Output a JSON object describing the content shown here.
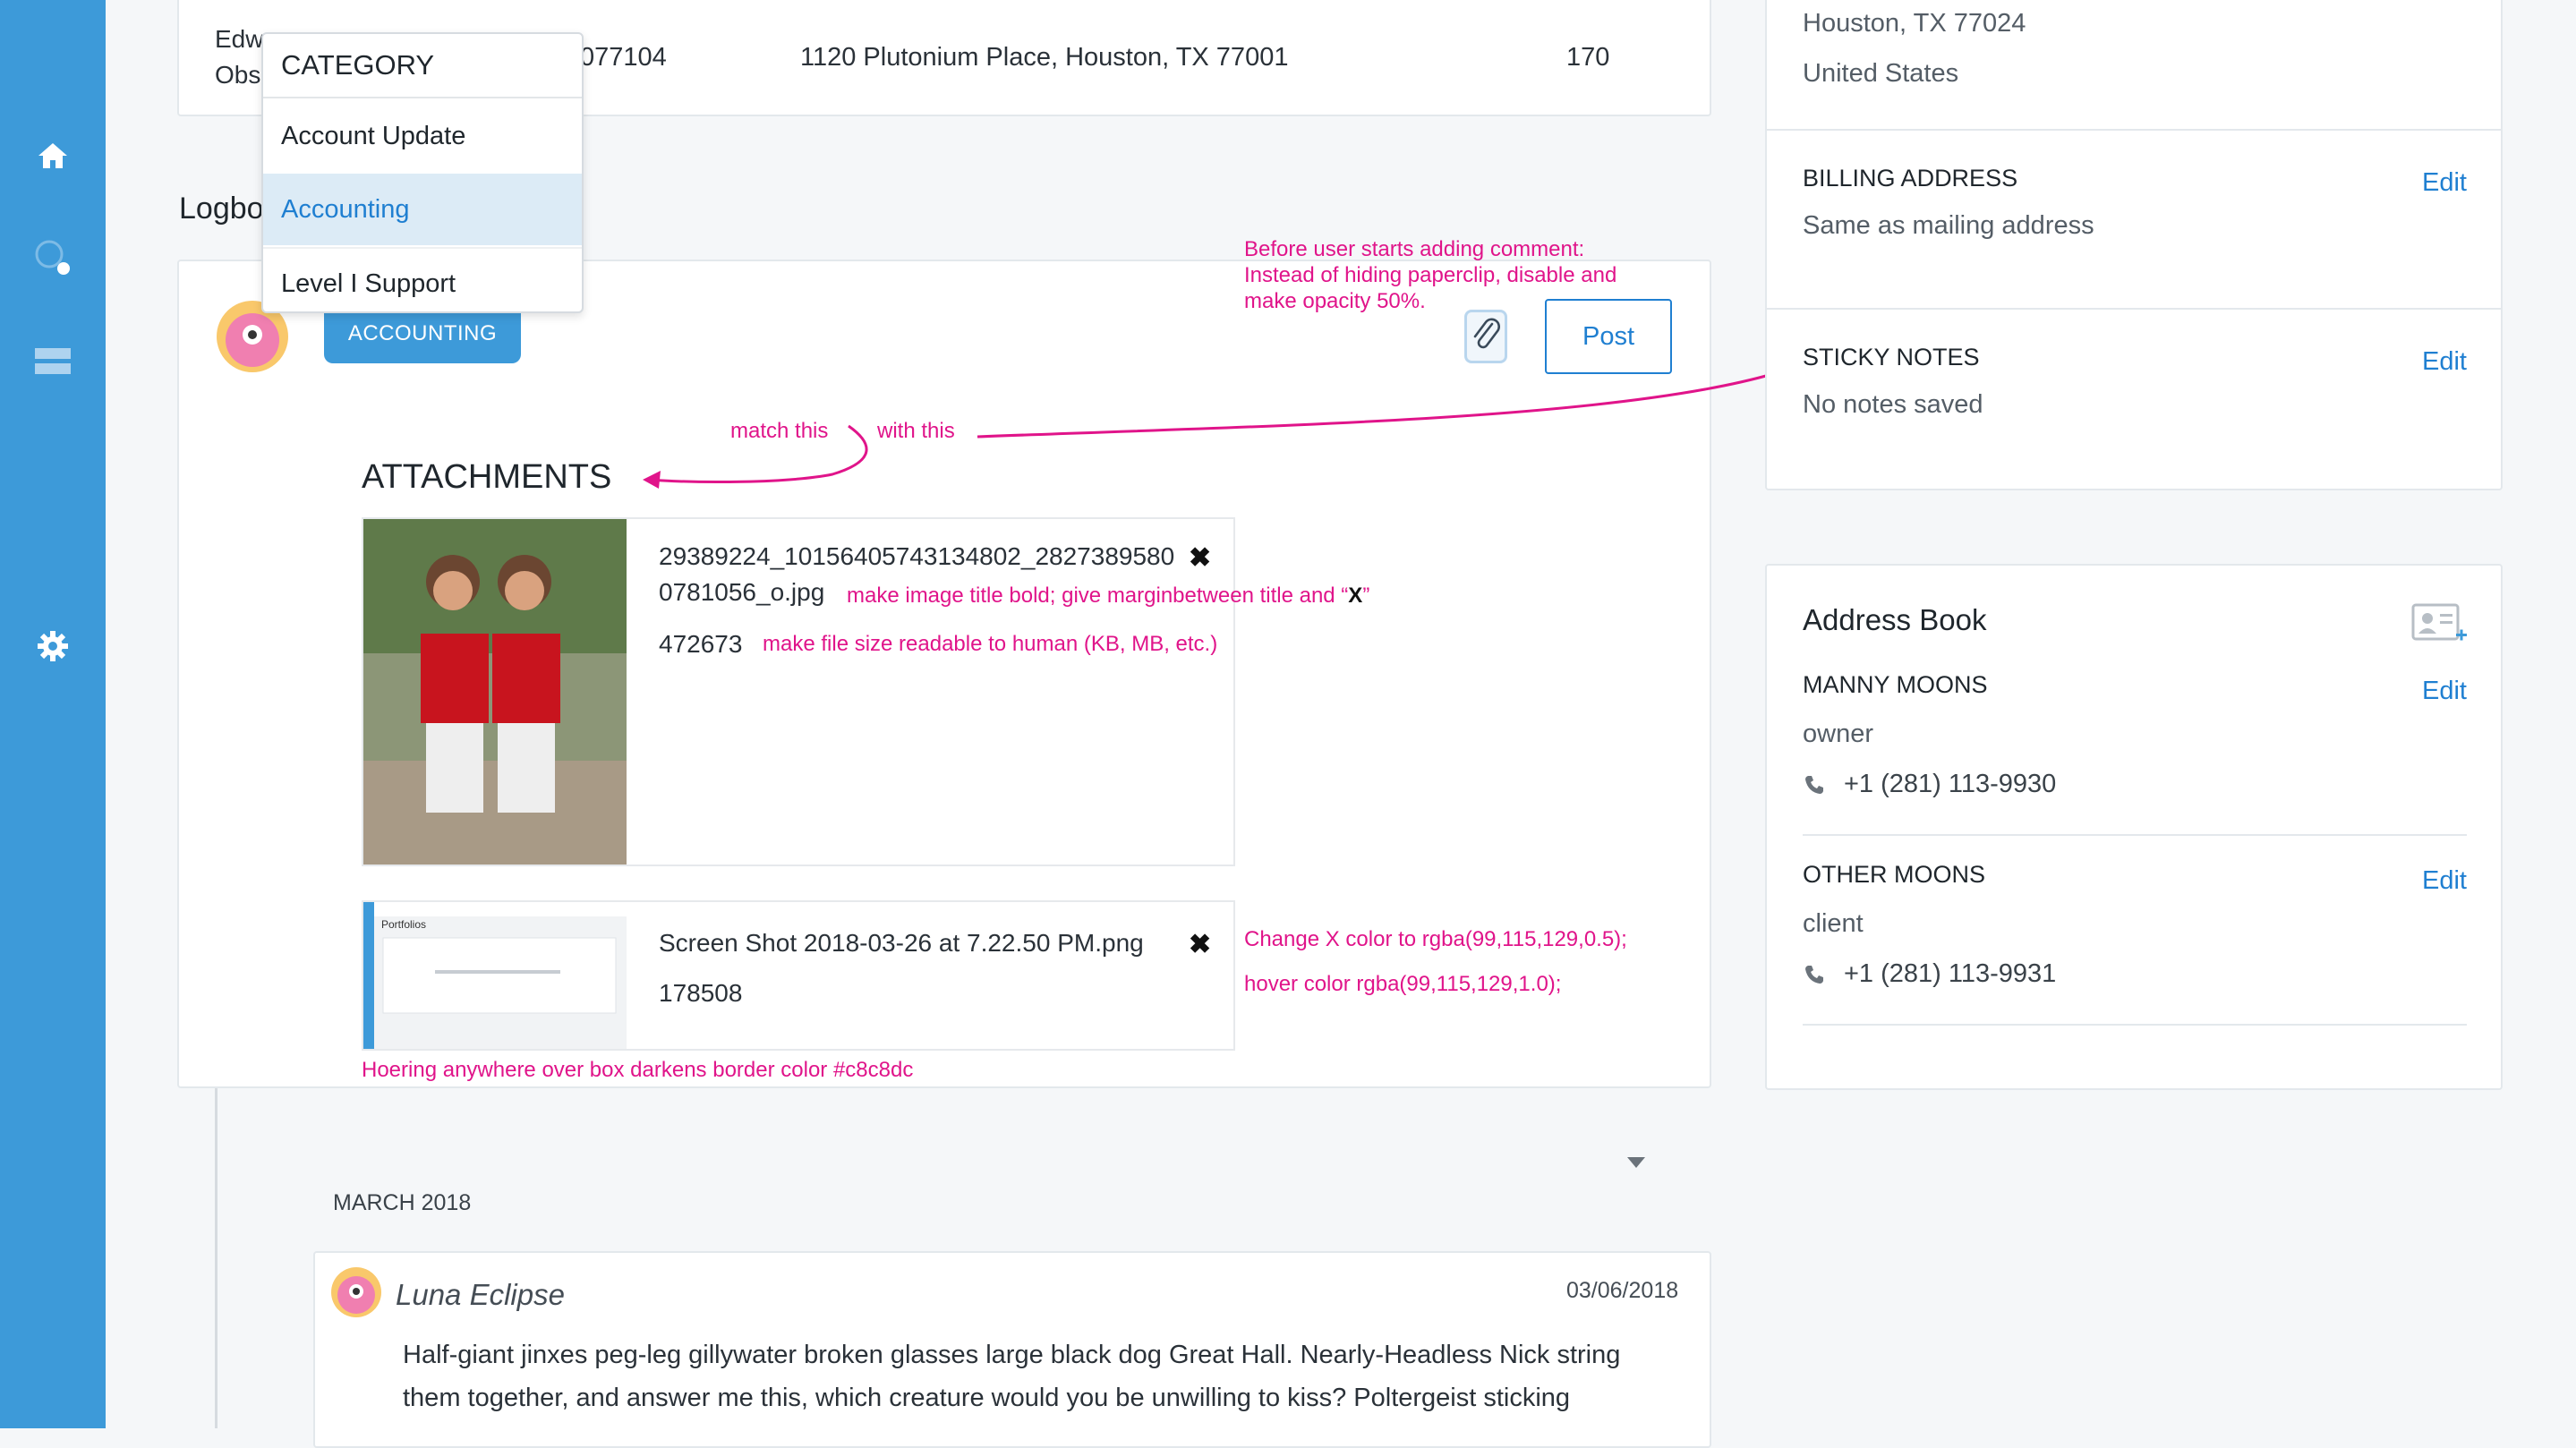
{
  "colors": {
    "sidebar": "#3d9ad9",
    "accent": "#1f7fd1",
    "annotation": "#e0148a"
  },
  "sidebar": {
    "icons": [
      "home-icon",
      "search-icon",
      "layers-icon",
      "gear-icon"
    ]
  },
  "table_row": {
    "name_line1": "Edw",
    "name_line2": "Obs",
    "phone_partial": "077104",
    "address": "1120 Plutonium Place, Houston, TX 77001",
    "count": "170"
  },
  "logbook": {
    "title_partial": "Logbo",
    "category_dropdown": {
      "header": "CATEGORY",
      "options": [
        "Account Update",
        "Accounting",
        "Level I Support"
      ],
      "selected": "Accounting"
    },
    "badge": "ACCOUNTING",
    "post_label": "Post",
    "attachments_title": "ATTACHMENTS",
    "attachments": [
      {
        "title_line1": "29389224_10156405743134802_2827389580",
        "title_line2": "0781056_o.jpg",
        "size": "472673",
        "remove": "✖"
      },
      {
        "title": "Screen Shot 2018-03-26 at 7.22.50 PM.png",
        "size": "178508",
        "remove": "✖",
        "thumb_text": "Portfolios"
      }
    ]
  },
  "annotations": {
    "paperclip": [
      "Before user starts adding comment:",
      "Instead of hiding paperclip, disable and",
      "make opacity 50%."
    ],
    "match_this": "match this",
    "with_this": "with this",
    "title_bold": "make image title bold; give marginbetween title and “",
    "title_bold_x": "X",
    "title_bold_end": "”",
    "file_size": "make file size readable to human (KB, MB, etc.)",
    "x_color": "Change X color to rgba(99,115,129,0.5);",
    "hover_color": "hover color  rgba(99,115,129,1.0);",
    "hover_box": "Hoering anywhere over box darkens border color #c8c8dc"
  },
  "timeline": {
    "month": "MARCH 2018",
    "entry": {
      "author": "Luna Eclipse",
      "date": "03/06/2018",
      "line1": "Half-giant jinxes peg-leg gillywater broken glasses large black dog Great Hall. Nearly-Headless Nick string",
      "line2": "them together, and answer me this, which creature would you be unwilling to kiss? Poltergeist sticking"
    }
  },
  "right_panel": {
    "mailing_city": "Houston, TX 77024",
    "mailing_country": "United States",
    "billing_label": "BILLING ADDRESS",
    "billing_value": "Same as mailing address",
    "sticky_label": "STICKY NOTES",
    "sticky_value": "No notes saved",
    "edit_label": "Edit",
    "address_book": {
      "title": "Address Book",
      "contacts": [
        {
          "name": "MANNY MOONS",
          "role": "owner",
          "phone": "+1 (281) 113-9930"
        },
        {
          "name": "OTHER MOONS",
          "role": "client",
          "phone": "+1 (281) 113-9931"
        }
      ]
    }
  }
}
